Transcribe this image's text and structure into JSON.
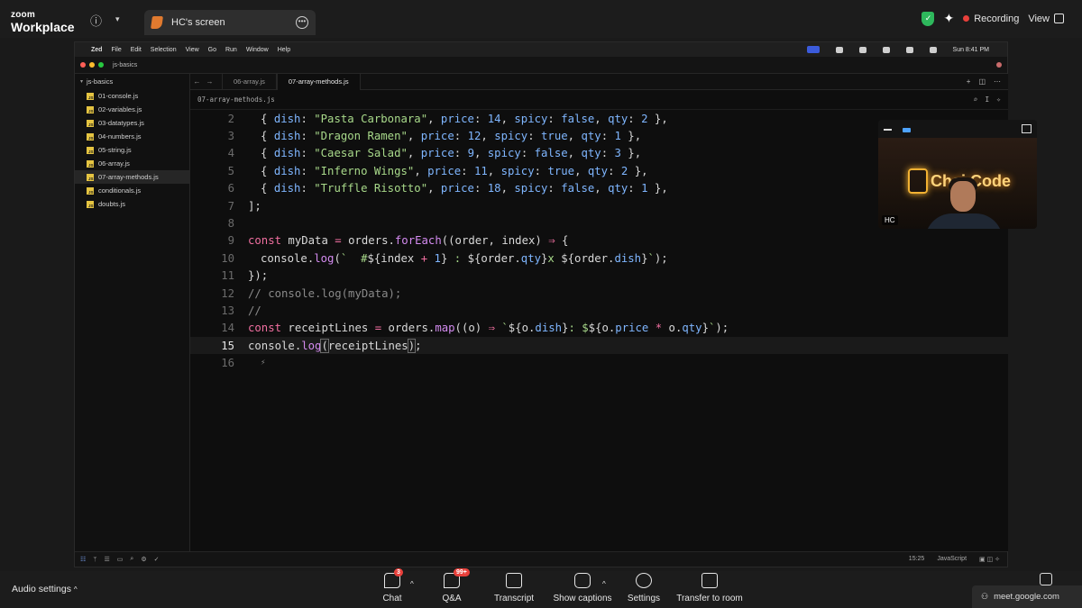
{
  "zoom": {
    "logo_line1": "zoom",
    "logo_line2": "Workplace",
    "share_title": "HC's screen",
    "recording_label": "Recording",
    "view_label": "View",
    "audio_label": "Audio settings",
    "toolbar": [
      {
        "label": "Chat",
        "badge": "3",
        "icon": "chat-icon"
      },
      {
        "label": "Q&A",
        "badge": "99+",
        "icon": "qa-icon"
      },
      {
        "label": "Transcript",
        "badge": "",
        "icon": "transcript-icon"
      },
      {
        "label": "Show captions",
        "badge": "",
        "icon": "cc-icon"
      },
      {
        "label": "Settings",
        "badge": "",
        "icon": "gear-icon"
      },
      {
        "label": "Transfer to room",
        "badge": "",
        "icon": "cast-icon"
      }
    ],
    "meet_url": "meet.google.com"
  },
  "mac": {
    "menu": [
      "Zed",
      "File",
      "Edit",
      "Selection",
      "View",
      "Go",
      "Run",
      "Window",
      "Help"
    ],
    "clock": "Sun 8:41 PM"
  },
  "zed": {
    "project": "js-basics",
    "sidebar_root": "js-basics",
    "files": [
      "01-console.js",
      "02-variables.js",
      "03-datatypes.js",
      "04-numbers.js",
      "05-string.js",
      "06-array.js",
      "07-array-methods.js",
      "conditionals.js",
      "doubts.js"
    ],
    "active_file_index": 6,
    "tabs": [
      "06-array.js",
      "07-array-methods.js"
    ],
    "breadcrumb": "07-array-methods.js",
    "status_position": "15:25",
    "status_language": "JavaScript",
    "line_numbers": [
      "2",
      "3",
      "4",
      "5",
      "6",
      "7",
      "8",
      "9",
      "10",
      "11",
      "12",
      "13",
      "14",
      "15",
      "16"
    ],
    "current_line": "15"
  },
  "cam": {
    "brand_text": "Chai Code",
    "label": "HC"
  },
  "colors": {
    "keyword": "#f06fa0",
    "string": "#a8d98a",
    "number": "#7fb6ff",
    "function": "#d48bf0",
    "recording_dot": "#e8403b",
    "shield": "#2eb85c"
  }
}
